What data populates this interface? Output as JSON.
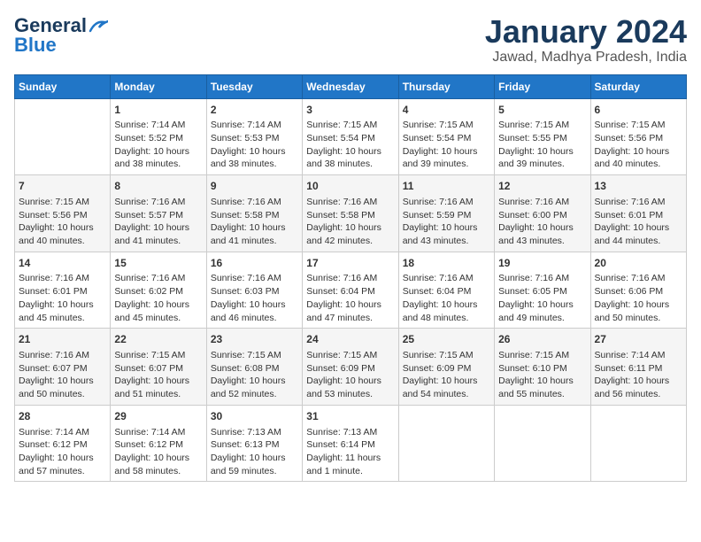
{
  "header": {
    "logo_line1": "General",
    "logo_line2": "Blue",
    "title": "January 2024",
    "subtitle": "Jawad, Madhya Pradesh, India"
  },
  "weekdays": [
    "Sunday",
    "Monday",
    "Tuesday",
    "Wednesday",
    "Thursday",
    "Friday",
    "Saturday"
  ],
  "weeks": [
    [
      {
        "day": "",
        "sunrise": "",
        "sunset": "",
        "daylight": ""
      },
      {
        "day": "1",
        "sunrise": "Sunrise: 7:14 AM",
        "sunset": "Sunset: 5:52 PM",
        "daylight": "Daylight: 10 hours and 38 minutes."
      },
      {
        "day": "2",
        "sunrise": "Sunrise: 7:14 AM",
        "sunset": "Sunset: 5:53 PM",
        "daylight": "Daylight: 10 hours and 38 minutes."
      },
      {
        "day": "3",
        "sunrise": "Sunrise: 7:15 AM",
        "sunset": "Sunset: 5:54 PM",
        "daylight": "Daylight: 10 hours and 38 minutes."
      },
      {
        "day": "4",
        "sunrise": "Sunrise: 7:15 AM",
        "sunset": "Sunset: 5:54 PM",
        "daylight": "Daylight: 10 hours and 39 minutes."
      },
      {
        "day": "5",
        "sunrise": "Sunrise: 7:15 AM",
        "sunset": "Sunset: 5:55 PM",
        "daylight": "Daylight: 10 hours and 39 minutes."
      },
      {
        "day": "6",
        "sunrise": "Sunrise: 7:15 AM",
        "sunset": "Sunset: 5:56 PM",
        "daylight": "Daylight: 10 hours and 40 minutes."
      }
    ],
    [
      {
        "day": "7",
        "sunrise": "Sunrise: 7:15 AM",
        "sunset": "Sunset: 5:56 PM",
        "daylight": "Daylight: 10 hours and 40 minutes."
      },
      {
        "day": "8",
        "sunrise": "Sunrise: 7:16 AM",
        "sunset": "Sunset: 5:57 PM",
        "daylight": "Daylight: 10 hours and 41 minutes."
      },
      {
        "day": "9",
        "sunrise": "Sunrise: 7:16 AM",
        "sunset": "Sunset: 5:58 PM",
        "daylight": "Daylight: 10 hours and 41 minutes."
      },
      {
        "day": "10",
        "sunrise": "Sunrise: 7:16 AM",
        "sunset": "Sunset: 5:58 PM",
        "daylight": "Daylight: 10 hours and 42 minutes."
      },
      {
        "day": "11",
        "sunrise": "Sunrise: 7:16 AM",
        "sunset": "Sunset: 5:59 PM",
        "daylight": "Daylight: 10 hours and 43 minutes."
      },
      {
        "day": "12",
        "sunrise": "Sunrise: 7:16 AM",
        "sunset": "Sunset: 6:00 PM",
        "daylight": "Daylight: 10 hours and 43 minutes."
      },
      {
        "day": "13",
        "sunrise": "Sunrise: 7:16 AM",
        "sunset": "Sunset: 6:01 PM",
        "daylight": "Daylight: 10 hours and 44 minutes."
      }
    ],
    [
      {
        "day": "14",
        "sunrise": "Sunrise: 7:16 AM",
        "sunset": "Sunset: 6:01 PM",
        "daylight": "Daylight: 10 hours and 45 minutes."
      },
      {
        "day": "15",
        "sunrise": "Sunrise: 7:16 AM",
        "sunset": "Sunset: 6:02 PM",
        "daylight": "Daylight: 10 hours and 45 minutes."
      },
      {
        "day": "16",
        "sunrise": "Sunrise: 7:16 AM",
        "sunset": "Sunset: 6:03 PM",
        "daylight": "Daylight: 10 hours and 46 minutes."
      },
      {
        "day": "17",
        "sunrise": "Sunrise: 7:16 AM",
        "sunset": "Sunset: 6:04 PM",
        "daylight": "Daylight: 10 hours and 47 minutes."
      },
      {
        "day": "18",
        "sunrise": "Sunrise: 7:16 AM",
        "sunset": "Sunset: 6:04 PM",
        "daylight": "Daylight: 10 hours and 48 minutes."
      },
      {
        "day": "19",
        "sunrise": "Sunrise: 7:16 AM",
        "sunset": "Sunset: 6:05 PM",
        "daylight": "Daylight: 10 hours and 49 minutes."
      },
      {
        "day": "20",
        "sunrise": "Sunrise: 7:16 AM",
        "sunset": "Sunset: 6:06 PM",
        "daylight": "Daylight: 10 hours and 50 minutes."
      }
    ],
    [
      {
        "day": "21",
        "sunrise": "Sunrise: 7:16 AM",
        "sunset": "Sunset: 6:07 PM",
        "daylight": "Daylight: 10 hours and 50 minutes."
      },
      {
        "day": "22",
        "sunrise": "Sunrise: 7:15 AM",
        "sunset": "Sunset: 6:07 PM",
        "daylight": "Daylight: 10 hours and 51 minutes."
      },
      {
        "day": "23",
        "sunrise": "Sunrise: 7:15 AM",
        "sunset": "Sunset: 6:08 PM",
        "daylight": "Daylight: 10 hours and 52 minutes."
      },
      {
        "day": "24",
        "sunrise": "Sunrise: 7:15 AM",
        "sunset": "Sunset: 6:09 PM",
        "daylight": "Daylight: 10 hours and 53 minutes."
      },
      {
        "day": "25",
        "sunrise": "Sunrise: 7:15 AM",
        "sunset": "Sunset: 6:09 PM",
        "daylight": "Daylight: 10 hours and 54 minutes."
      },
      {
        "day": "26",
        "sunrise": "Sunrise: 7:15 AM",
        "sunset": "Sunset: 6:10 PM",
        "daylight": "Daylight: 10 hours and 55 minutes."
      },
      {
        "day": "27",
        "sunrise": "Sunrise: 7:14 AM",
        "sunset": "Sunset: 6:11 PM",
        "daylight": "Daylight: 10 hours and 56 minutes."
      }
    ],
    [
      {
        "day": "28",
        "sunrise": "Sunrise: 7:14 AM",
        "sunset": "Sunset: 6:12 PM",
        "daylight": "Daylight: 10 hours and 57 minutes."
      },
      {
        "day": "29",
        "sunrise": "Sunrise: 7:14 AM",
        "sunset": "Sunset: 6:12 PM",
        "daylight": "Daylight: 10 hours and 58 minutes."
      },
      {
        "day": "30",
        "sunrise": "Sunrise: 7:13 AM",
        "sunset": "Sunset: 6:13 PM",
        "daylight": "Daylight: 10 hours and 59 minutes."
      },
      {
        "day": "31",
        "sunrise": "Sunrise: 7:13 AM",
        "sunset": "Sunset: 6:14 PM",
        "daylight": "Daylight: 11 hours and 1 minute."
      },
      {
        "day": "",
        "sunrise": "",
        "sunset": "",
        "daylight": ""
      },
      {
        "day": "",
        "sunrise": "",
        "sunset": "",
        "daylight": ""
      },
      {
        "day": "",
        "sunrise": "",
        "sunset": "",
        "daylight": ""
      }
    ]
  ]
}
